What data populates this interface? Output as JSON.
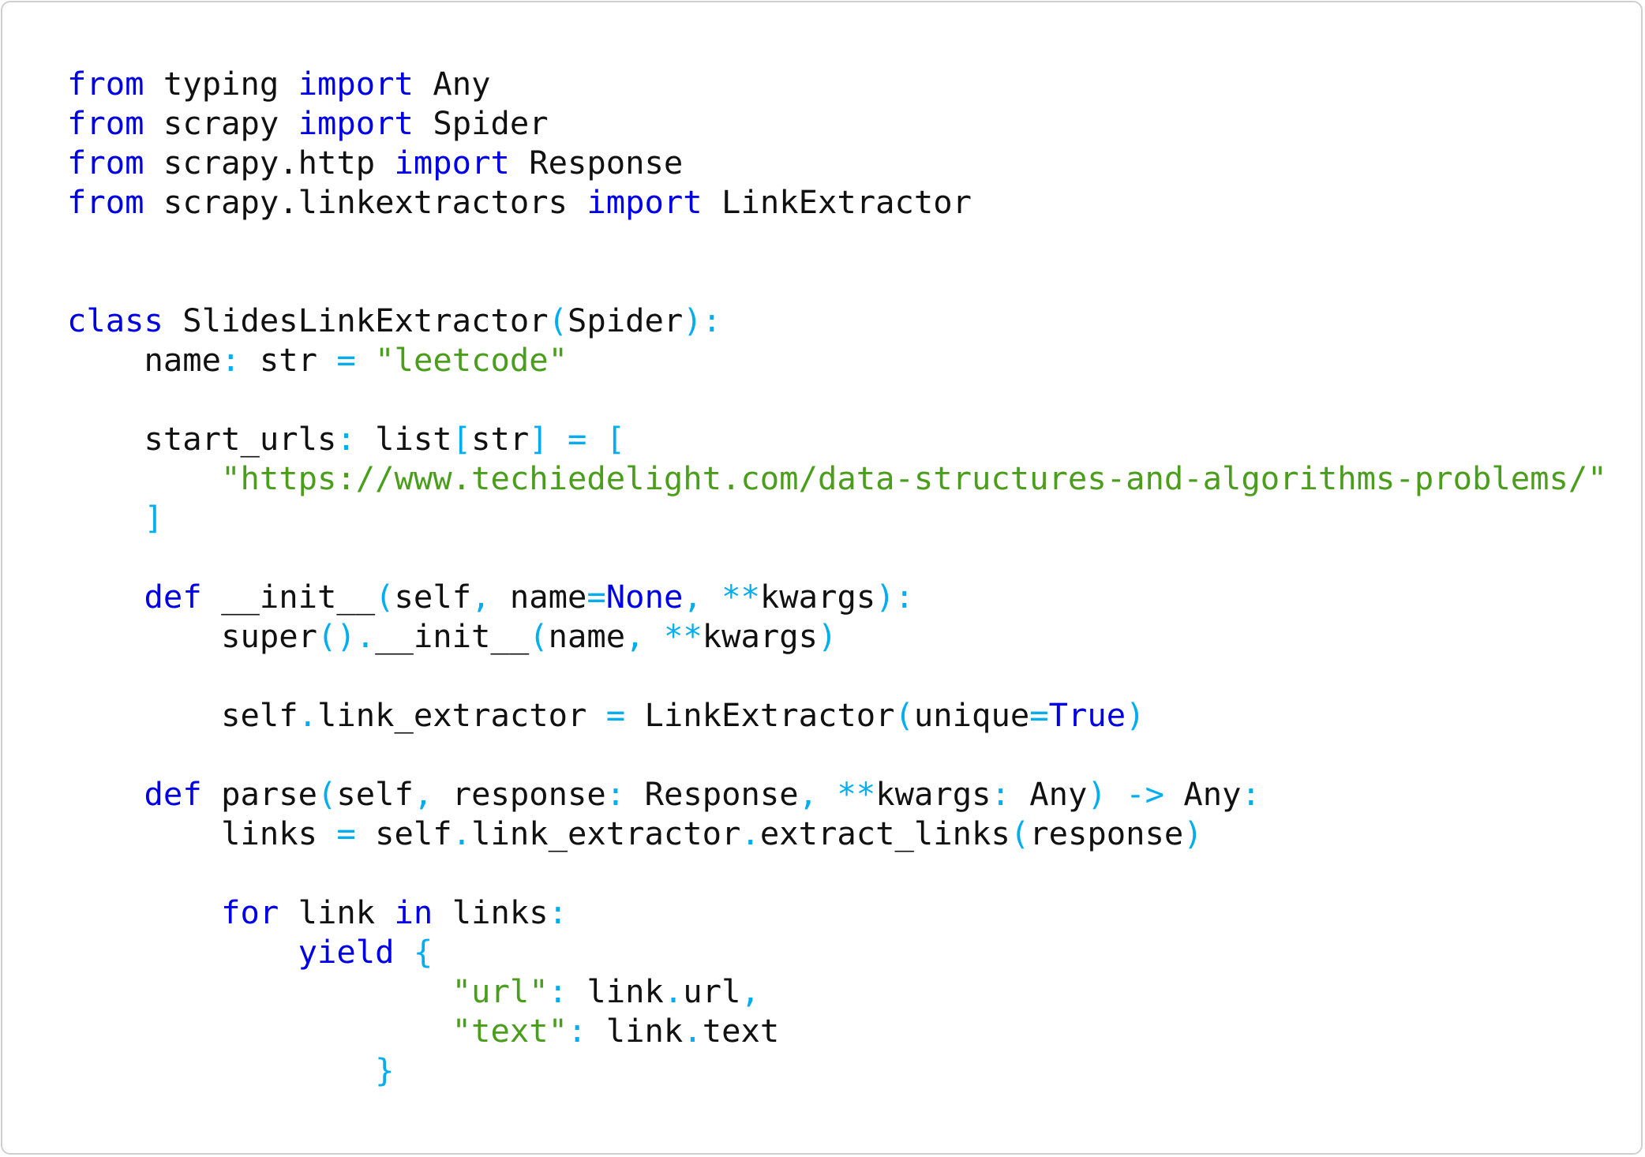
{
  "code": {
    "language": "python",
    "colors": {
      "keyword": "#0000e6",
      "punctuation": "#00aeef",
      "string": "#4a9e1c",
      "text": "#111111"
    },
    "lines": [
      [
        [
          "k",
          "from"
        ],
        [
          "t",
          " typing "
        ],
        [
          "k",
          "import"
        ],
        [
          "t",
          " Any"
        ]
      ],
      [
        [
          "k",
          "from"
        ],
        [
          "t",
          " scrapy "
        ],
        [
          "k",
          "import"
        ],
        [
          "t",
          " Spider"
        ]
      ],
      [
        [
          "k",
          "from"
        ],
        [
          "t",
          " scrapy.http "
        ],
        [
          "k",
          "import"
        ],
        [
          "t",
          " Response"
        ]
      ],
      [
        [
          "k",
          "from"
        ],
        [
          "t",
          " scrapy.linkextractors "
        ],
        [
          "k",
          "import"
        ],
        [
          "t",
          " LinkExtractor"
        ]
      ],
      [],
      [],
      [
        [
          "k",
          "class"
        ],
        [
          "t",
          " SlidesLinkExtractor"
        ],
        [
          "p",
          "("
        ],
        [
          "t",
          "Spider"
        ],
        [
          "p",
          "):"
        ]
      ],
      [
        [
          "t",
          "    name"
        ],
        [
          "p",
          ":"
        ],
        [
          "t",
          " str "
        ],
        [
          "p",
          "="
        ],
        [
          "t",
          " "
        ],
        [
          "s",
          "\"leetcode\""
        ]
      ],
      [],
      [
        [
          "t",
          "    start_urls"
        ],
        [
          "p",
          ":"
        ],
        [
          "t",
          " list"
        ],
        [
          "p",
          "["
        ],
        [
          "t",
          "str"
        ],
        [
          "p",
          "]"
        ],
        [
          "t",
          " "
        ],
        [
          "p",
          "="
        ],
        [
          "t",
          " "
        ],
        [
          "p",
          "["
        ]
      ],
      [
        [
          "t",
          "        "
        ],
        [
          "s",
          "\"https://www.techiedelight.com/data-structures-and-algorithms-problems/\""
        ]
      ],
      [
        [
          "t",
          "    "
        ],
        [
          "p",
          "]"
        ]
      ],
      [],
      [
        [
          "t",
          "    "
        ],
        [
          "k",
          "def"
        ],
        [
          "t",
          " __init__"
        ],
        [
          "p",
          "("
        ],
        [
          "t",
          "self"
        ],
        [
          "p",
          ","
        ],
        [
          "t",
          " name"
        ],
        [
          "p",
          "="
        ],
        [
          "k",
          "None"
        ],
        [
          "p",
          ","
        ],
        [
          "t",
          " "
        ],
        [
          "p",
          "**"
        ],
        [
          "t",
          "kwargs"
        ],
        [
          "p",
          "):"
        ]
      ],
      [
        [
          "t",
          "        super"
        ],
        [
          "p",
          "()."
        ],
        [
          "t",
          "__init__"
        ],
        [
          "p",
          "("
        ],
        [
          "t",
          "name"
        ],
        [
          "p",
          ","
        ],
        [
          "t",
          " "
        ],
        [
          "p",
          "**"
        ],
        [
          "t",
          "kwargs"
        ],
        [
          "p",
          ")"
        ]
      ],
      [],
      [
        [
          "t",
          "        self"
        ],
        [
          "p",
          "."
        ],
        [
          "t",
          "link_extractor "
        ],
        [
          "p",
          "="
        ],
        [
          "t",
          " LinkExtractor"
        ],
        [
          "p",
          "("
        ],
        [
          "t",
          "unique"
        ],
        [
          "p",
          "="
        ],
        [
          "k",
          "True"
        ],
        [
          "p",
          ")"
        ]
      ],
      [],
      [
        [
          "t",
          "    "
        ],
        [
          "k",
          "def"
        ],
        [
          "t",
          " parse"
        ],
        [
          "p",
          "("
        ],
        [
          "t",
          "self"
        ],
        [
          "p",
          ","
        ],
        [
          "t",
          " response"
        ],
        [
          "p",
          ":"
        ],
        [
          "t",
          " Response"
        ],
        [
          "p",
          ","
        ],
        [
          "t",
          " "
        ],
        [
          "p",
          "**"
        ],
        [
          "t",
          "kwargs"
        ],
        [
          "p",
          ":"
        ],
        [
          "t",
          " Any"
        ],
        [
          "p",
          ")"
        ],
        [
          "t",
          " "
        ],
        [
          "p",
          "->"
        ],
        [
          "t",
          " Any"
        ],
        [
          "p",
          ":"
        ]
      ],
      [
        [
          "t",
          "        links "
        ],
        [
          "p",
          "="
        ],
        [
          "t",
          " self"
        ],
        [
          "p",
          "."
        ],
        [
          "t",
          "link_extractor"
        ],
        [
          "p",
          "."
        ],
        [
          "t",
          "extract_links"
        ],
        [
          "p",
          "("
        ],
        [
          "t",
          "response"
        ],
        [
          "p",
          ")"
        ]
      ],
      [],
      [
        [
          "t",
          "        "
        ],
        [
          "k",
          "for"
        ],
        [
          "t",
          " link "
        ],
        [
          "k",
          "in"
        ],
        [
          "t",
          " links"
        ],
        [
          "p",
          ":"
        ]
      ],
      [
        [
          "t",
          "            "
        ],
        [
          "k",
          "yield"
        ],
        [
          "t",
          " "
        ],
        [
          "p",
          "{"
        ]
      ],
      [
        [
          "t",
          "                    "
        ],
        [
          "s",
          "\"url\""
        ],
        [
          "p",
          ":"
        ],
        [
          "t",
          " link"
        ],
        [
          "p",
          "."
        ],
        [
          "t",
          "url"
        ],
        [
          "p",
          ","
        ]
      ],
      [
        [
          "t",
          "                    "
        ],
        [
          "s",
          "\"text\""
        ],
        [
          "p",
          ":"
        ],
        [
          "t",
          " link"
        ],
        [
          "p",
          "."
        ],
        [
          "t",
          "text"
        ]
      ],
      [
        [
          "t",
          "                "
        ],
        [
          "p",
          "}"
        ]
      ]
    ]
  }
}
